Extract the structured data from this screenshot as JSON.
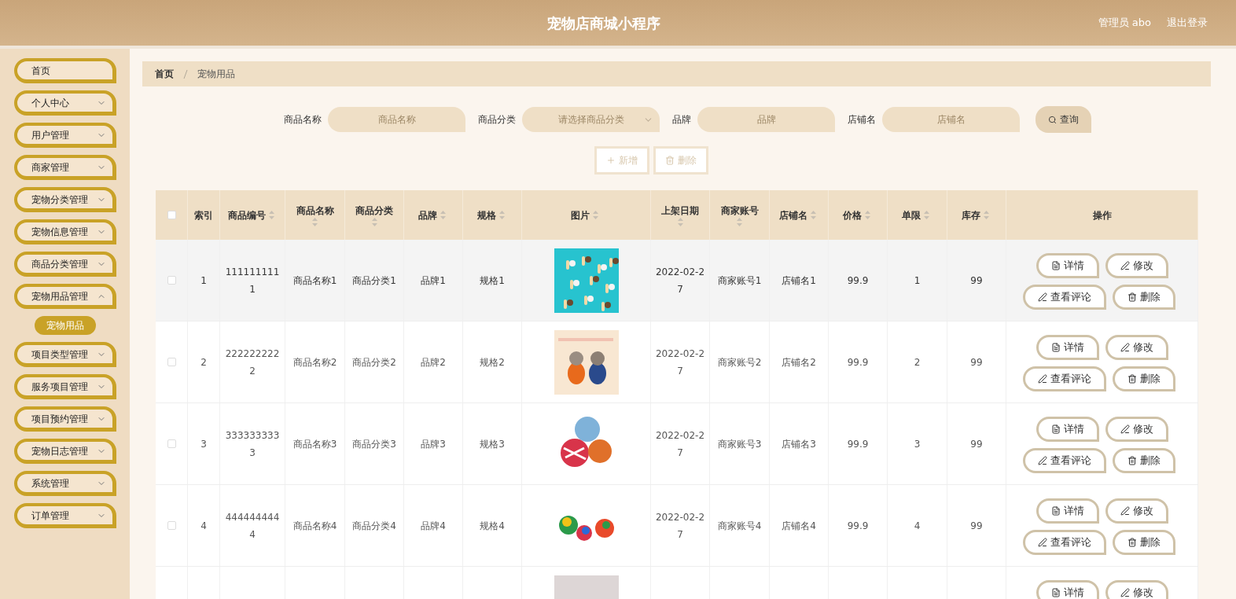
{
  "header": {
    "title": "宠物店商城小程序",
    "user": "管理员 abo",
    "logout": "退出登录"
  },
  "sidebar": {
    "items": [
      {
        "label": "首页",
        "kind": "link"
      },
      {
        "label": "个人中心",
        "kind": "menu",
        "expanded": false
      },
      {
        "label": "用户管理",
        "kind": "menu",
        "expanded": false
      },
      {
        "label": "商家管理",
        "kind": "menu",
        "expanded": false
      },
      {
        "label": "宠物分类管理",
        "kind": "menu",
        "expanded": false
      },
      {
        "label": "宠物信息管理",
        "kind": "menu",
        "expanded": false
      },
      {
        "label": "商品分类管理",
        "kind": "menu",
        "expanded": false
      },
      {
        "label": "宠物用品管理",
        "kind": "menu",
        "expanded": true,
        "children": [
          {
            "label": "宠物用品",
            "selected": true
          }
        ]
      },
      {
        "label": "项目类型管理",
        "kind": "menu",
        "expanded": false
      },
      {
        "label": "服务项目管理",
        "kind": "menu",
        "expanded": false
      },
      {
        "label": "项目预约管理",
        "kind": "menu",
        "expanded": false
      },
      {
        "label": "宠物日志管理",
        "kind": "menu",
        "expanded": false
      },
      {
        "label": "系统管理",
        "kind": "menu",
        "expanded": false
      },
      {
        "label": "订单管理",
        "kind": "menu",
        "expanded": false
      }
    ]
  },
  "breadcrumb": [
    "首页",
    "宠物用品"
  ],
  "search": {
    "fields": [
      {
        "label": "商品名称",
        "placeholder": "商品名称",
        "kind": "input"
      },
      {
        "label": "商品分类",
        "placeholder": "请选择商品分类",
        "kind": "select"
      },
      {
        "label": "品牌",
        "placeholder": "品牌",
        "kind": "input"
      },
      {
        "label": "店铺名",
        "placeholder": "店铺名",
        "kind": "input"
      }
    ],
    "button": "查询"
  },
  "actions": [
    {
      "label": "新增",
      "kind": "add"
    },
    {
      "label": "删除",
      "kind": "delete"
    }
  ],
  "table": {
    "columns": [
      {
        "label": "索引",
        "sortable": false
      },
      {
        "label": "商品编号",
        "sortable": true
      },
      {
        "label": "商品名称",
        "sortable": true
      },
      {
        "label": "商品分类",
        "sortable": true
      },
      {
        "label": "品牌",
        "sortable": true
      },
      {
        "label": "规格",
        "sortable": true
      },
      {
        "label": "图片",
        "sortable": true
      },
      {
        "label": "上架日期",
        "sortable": true
      },
      {
        "label": "商家账号",
        "sortable": true
      },
      {
        "label": "店铺名",
        "sortable": true
      },
      {
        "label": "价格",
        "sortable": true
      },
      {
        "label": "单限",
        "sortable": true
      },
      {
        "label": "库存",
        "sortable": true
      },
      {
        "label": "操作",
        "sortable": false
      }
    ],
    "select_all_checked": false,
    "rows": [
      {
        "highlighted": true,
        "checked": false,
        "cells": [
          "1",
          "1111111111",
          "商品名称1",
          "商品分类1",
          "品牌1",
          "规格1",
          null,
          "2022-02-27",
          "商家账号1",
          "店铺名1",
          "99.9",
          "1",
          "99"
        ],
        "buttons": [
          {
            "label": "详情",
            "kind": "detail"
          },
          {
            "label": "修改",
            "kind": "edit"
          },
          {
            "label": "查看评论",
            "kind": "edit"
          },
          {
            "label": "删除",
            "kind": "delete"
          }
        ]
      },
      {
        "highlighted": false,
        "checked": false,
        "cells": [
          "2",
          "2222222222",
          "商品名称2",
          "商品分类2",
          "品牌2",
          "规格2",
          null,
          "2022-02-27",
          "商家账号2",
          "店铺名2",
          "99.9",
          "2",
          "99"
        ],
        "buttons": [
          {
            "label": "详情",
            "kind": "detail"
          },
          {
            "label": "修改",
            "kind": "edit"
          },
          {
            "label": "查看评论",
            "kind": "edit"
          },
          {
            "label": "删除",
            "kind": "delete"
          }
        ]
      },
      {
        "highlighted": false,
        "checked": false,
        "cells": [
          "3",
          "3333333333",
          "商品名称3",
          "商品分类3",
          "品牌3",
          "规格3",
          null,
          "2022-02-27",
          "商家账号3",
          "店铺名3",
          "99.9",
          "3",
          "99"
        ],
        "buttons": [
          {
            "label": "详情",
            "kind": "detail"
          },
          {
            "label": "修改",
            "kind": "edit"
          },
          {
            "label": "查看评论",
            "kind": "edit"
          },
          {
            "label": "删除",
            "kind": "delete"
          }
        ]
      },
      {
        "highlighted": false,
        "checked": false,
        "cells": [
          "4",
          "4444444444",
          "商品名称4",
          "商品分类4",
          "品牌4",
          "规格4",
          null,
          "2022-02-27",
          "商家账号4",
          "店铺名4",
          "99.9",
          "4",
          "99"
        ],
        "buttons": [
          {
            "label": "详情",
            "kind": "detail"
          },
          {
            "label": "修改",
            "kind": "edit"
          },
          {
            "label": "查看评论",
            "kind": "edit"
          },
          {
            "label": "删除",
            "kind": "delete"
          }
        ]
      },
      {
        "buttons": [
          {
            "label": "详情",
            "kind": "detail"
          },
          {
            "label": "修改",
            "kind": "edit"
          }
        ]
      }
    ]
  }
}
